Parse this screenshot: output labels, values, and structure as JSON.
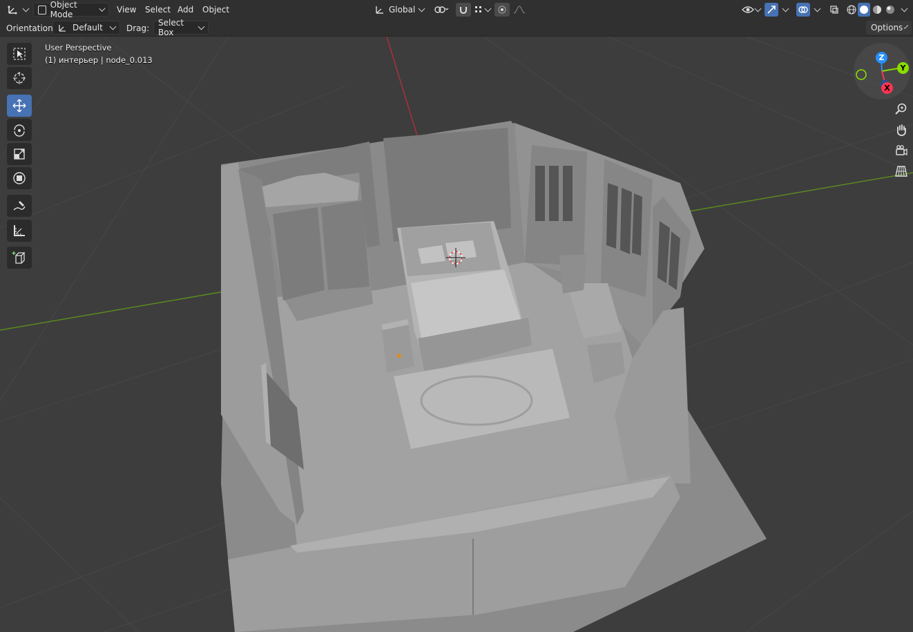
{
  "header": {
    "editor_type_icon": "axes-editor-icon",
    "mode_label": "Object Mode",
    "menus": [
      "View",
      "Select",
      "Add",
      "Object"
    ],
    "transform_orientation": "Global",
    "options_label": "Options"
  },
  "tool_settings": {
    "orientation_label": "Orientation:",
    "orientation_value": "Default",
    "drag_label": "Drag:",
    "drag_value": "Select Box"
  },
  "viewport": {
    "view_name": "User Perspective",
    "object_info": "(1) интерьер | node_0.013"
  },
  "gizmo": {
    "z_label": "Z",
    "y_label": "Y",
    "x_label": "X"
  },
  "toolbar": {
    "tools": [
      "select-box",
      "cursor",
      "move",
      "rotate",
      "scale",
      "transform",
      "annotate",
      "measure",
      "add-cube"
    ],
    "active_tool": "move"
  },
  "colors": {
    "header_bg": "#303030",
    "viewport_bg": "#3d3d3d",
    "active_tool": "#4772b3",
    "axis_x": "#ff3352",
    "axis_y": "#8bdc00",
    "axis_z": "#2890ff"
  }
}
